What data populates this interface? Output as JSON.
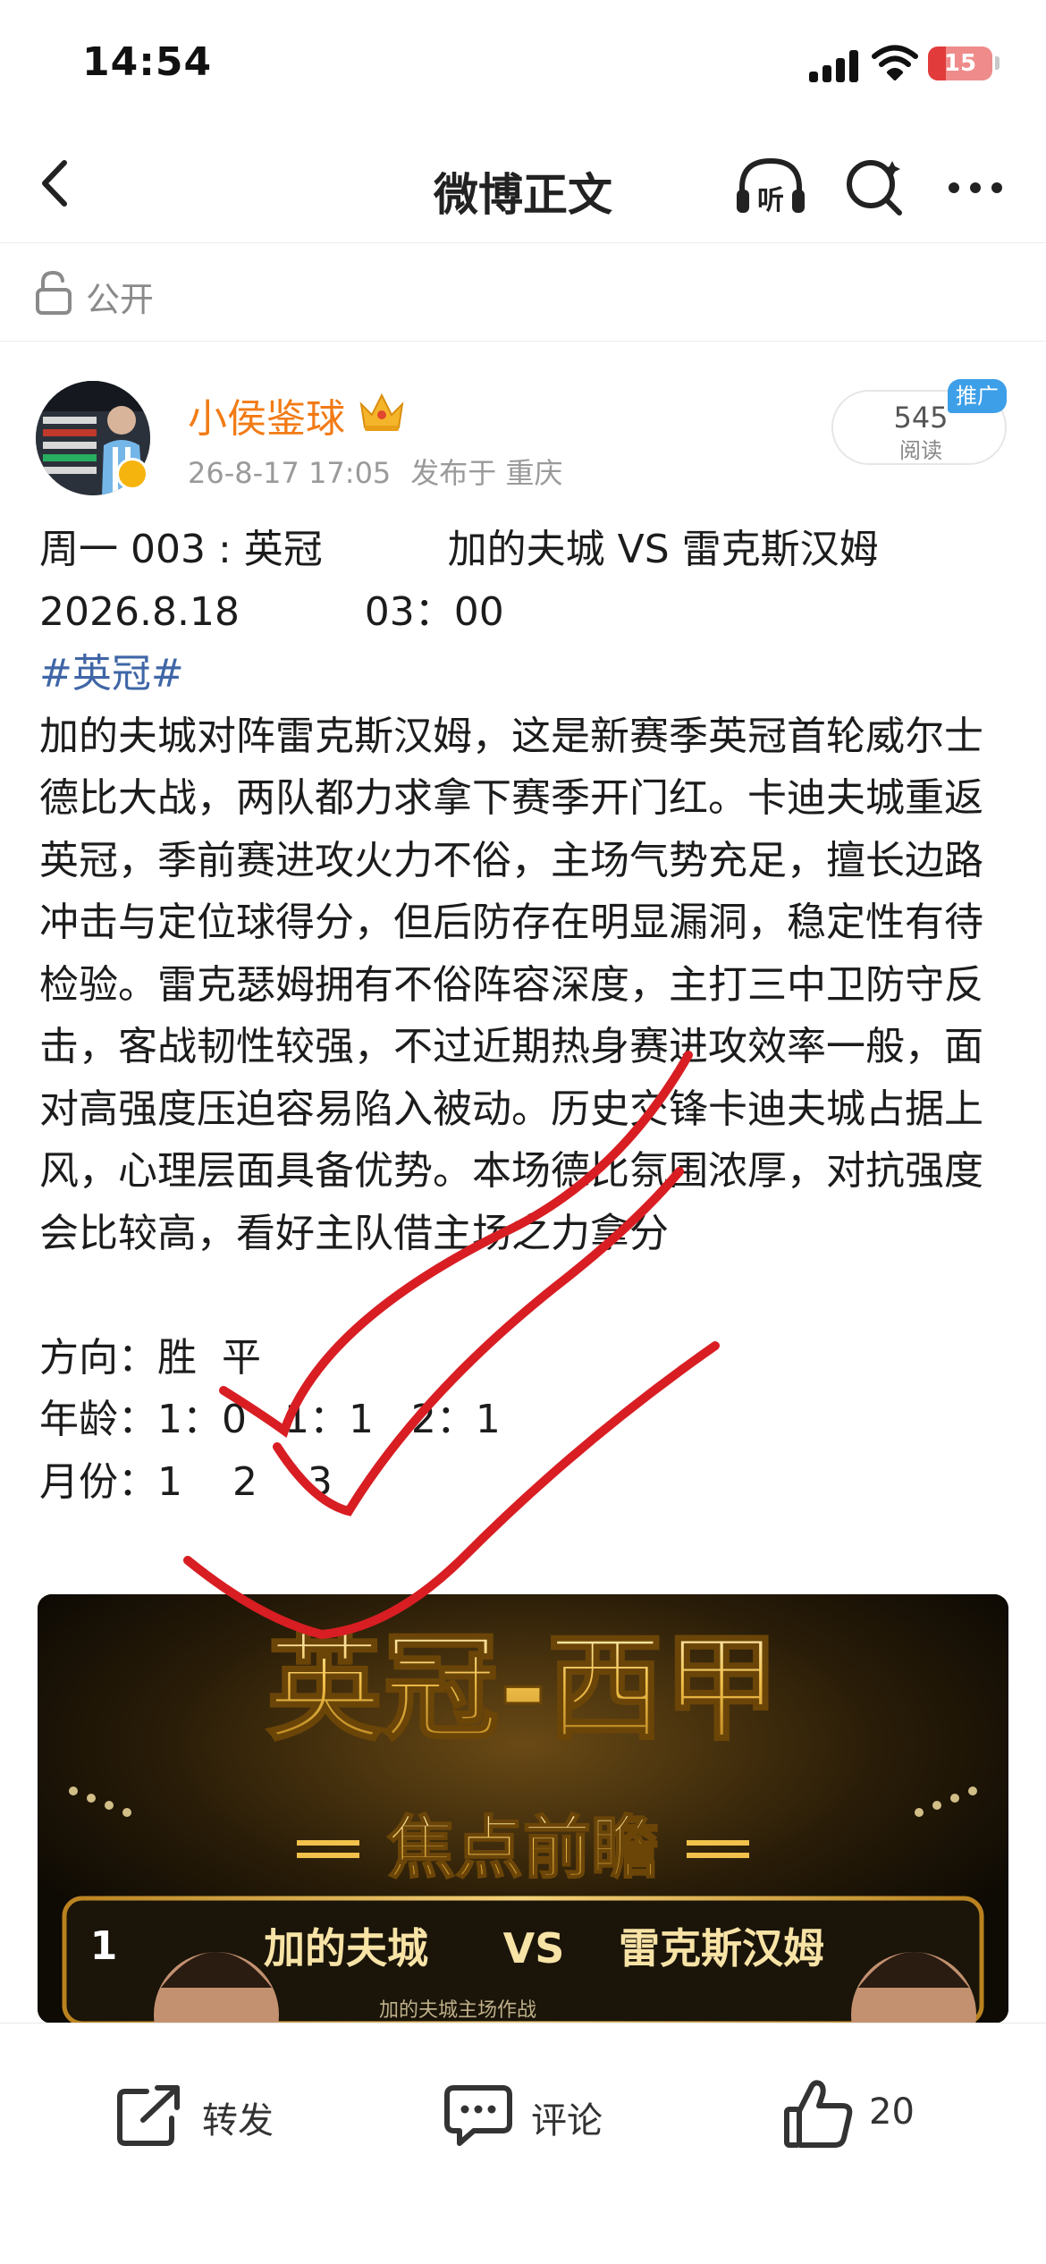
{
  "status_bar": {
    "time": "14:54",
    "battery": "15",
    "battery_color": "#e23b3b"
  },
  "nav": {
    "title": "微博正文",
    "listen_label": "听"
  },
  "visibility": {
    "label": "公开"
  },
  "author": {
    "name": "小侯鉴球",
    "name_color": "#f27b16",
    "posted_at": "26-8-17 17:05",
    "location": "发布于 重庆"
  },
  "reads": {
    "count": "545",
    "label": "阅读",
    "tag": "推广"
  },
  "post": {
    "match_line": "周一 003 : 英冠          加的夫城 VS 雷克斯汉姆",
    "time_line": "2026.8.18          03：00",
    "hashtag": "#英冠#",
    "analysis": "加的夫城对阵雷克斯汉姆，这是新赛季英冠首轮威尔士德比大战，两队都力求拿下赛季开门红。卡迪夫城重返英冠，季前赛进攻火力不俗，主场气势充足，擅长边路冲击与定位球得分，但后防存在明显漏洞，稳定性有待检验。雷克瑟姆拥有不俗阵容深度，主打三中卫防守反击，客战韧性较强，不过近期热身赛进攻效率一般，面对高强度压迫容易陷入被动。历史交锋卡迪夫城占据上风，心理层面具备优势。本场德比氛围浓厚，对抗强度会比较高，看好主队借主场之力拿分",
    "direction_line": "方向：胜  平",
    "age_line": "年龄：1：0   1：1   2：1",
    "month_line": "月份：1    2    3"
  },
  "image": {
    "headline": "英冠-西甲",
    "subheadline": "焦点前瞻",
    "rank": "1",
    "home_team": "加的夫城",
    "vs": "VS",
    "away_team": "雷克斯汉姆",
    "caption": "加的夫城主场作战"
  },
  "actions": {
    "repost": "转发",
    "comment": "评论",
    "like_count": "20"
  }
}
